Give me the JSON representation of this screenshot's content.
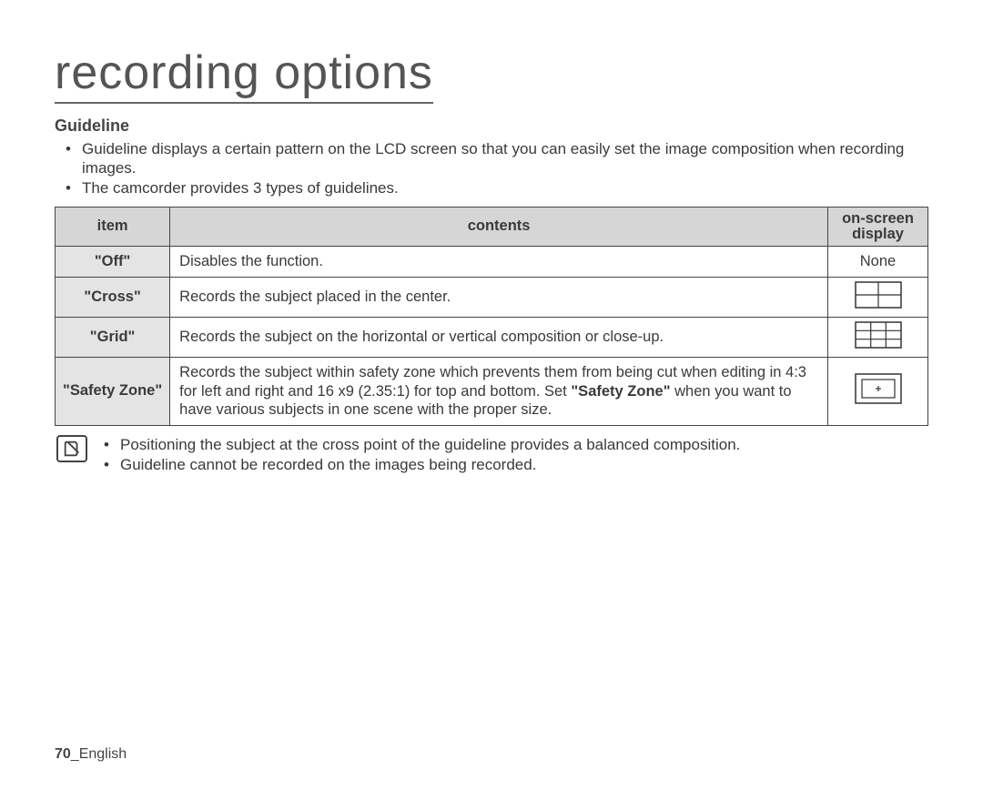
{
  "title": "recording options",
  "section_heading": "Guideline",
  "intro_bullets": [
    "Guideline displays a certain pattern on the LCD screen so that you can easily set the image composition when recording images.",
    "The camcorder provides 3 types of guidelines."
  ],
  "table": {
    "headers": {
      "item": "item",
      "contents": "contents",
      "osd_line1": "on-screen",
      "osd_line2": "display"
    },
    "rows": {
      "off": {
        "item": "\"Off\"",
        "contents_plain": "Disables the function.",
        "osd_text": "None"
      },
      "cross": {
        "item": "\"Cross\"",
        "contents_plain": "Records the subject placed in the center."
      },
      "grid": {
        "item": "\"Grid\"",
        "contents_plain": "Records the subject on the horizontal or vertical composition or close-up."
      },
      "safety": {
        "item": "\"Safety Zone\"",
        "contents_pre": "Records the subject within safety zone which prevents them from being cut when editing in 4:3 for left and right and 16 x9 (2.35:1) for top and bottom. Set ",
        "contents_bold": "\"Safety Zone\"",
        "contents_post": " when you want to have various subjects in one scene with the proper size."
      }
    }
  },
  "notes": [
    "Positioning the subject at the cross point of the guideline provides a balanced composition.",
    "Guideline cannot be recorded on the images being recorded."
  ],
  "footer": {
    "page": "70",
    "sep": "_",
    "lang": "English"
  }
}
